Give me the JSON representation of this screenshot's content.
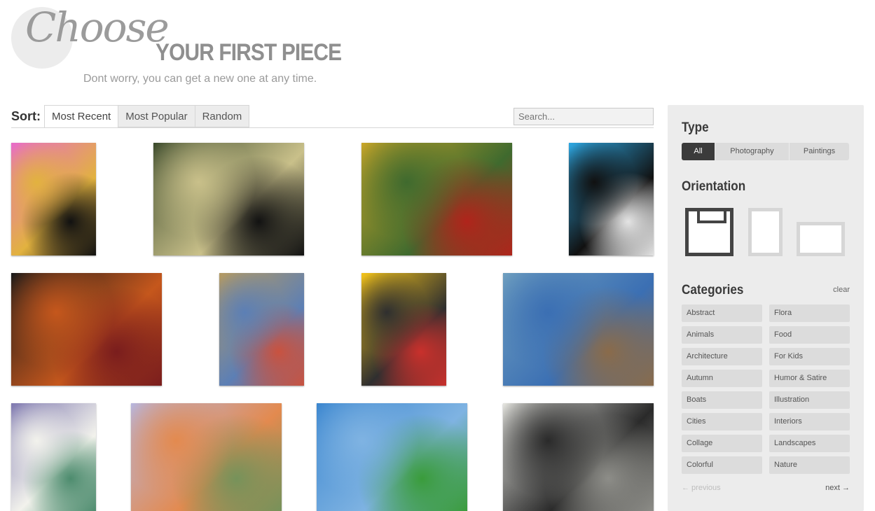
{
  "header": {
    "script_word": "Choose",
    "title": "YOUR FIRST PIECE",
    "subtitle": "Dont worry, you can get a new one at any time."
  },
  "sort": {
    "label": "Sort:",
    "tabs": [
      "Most Recent",
      "Most Popular",
      "Random"
    ],
    "active_tab": "Most Recent",
    "search_placeholder": "Search..."
  },
  "gallery": [
    {
      "name": "marilyn-license-plate-art",
      "colors": [
        "#e86cc9",
        "#e2b23f",
        "#111111"
      ]
    },
    {
      "name": "plaid-fabric-abstract",
      "colors": [
        "#3b4a2c",
        "#c9c08a",
        "#121212"
      ]
    },
    {
      "name": "harlequin-fabric-abstract",
      "colors": [
        "#c9a629",
        "#3f6a2e",
        "#b0241b"
      ]
    },
    {
      "name": "kurt-license-plate-art",
      "colors": [
        "#2ea8e3",
        "#111111",
        "#e4e4e4"
      ]
    },
    {
      "name": "dark-floral-abstract",
      "colors": [
        "#1a1a1a",
        "#c5571c",
        "#7a1d1d"
      ]
    },
    {
      "name": "colorful-swirl-painting",
      "colors": [
        "#b49a63",
        "#5c7fb5",
        "#c9523f"
      ]
    },
    {
      "name": "rosie-license-plate-art",
      "colors": [
        "#f3c31a",
        "#2f2f2f",
        "#c9302c"
      ]
    },
    {
      "name": "long-boat-photo",
      "colors": [
        "#6f9fbf",
        "#3b6fb3",
        "#8a6b4a"
      ]
    },
    {
      "name": "white-flowers-vase",
      "colors": [
        "#7f79b0",
        "#f2f2ec",
        "#4d8c6e"
      ]
    },
    {
      "name": "landscape-field-painting",
      "colors": [
        "#b7b6de",
        "#e38a4f",
        "#76925a"
      ]
    },
    {
      "name": "blue-sky-green-field",
      "colors": [
        "#3b86cf",
        "#7fb3e2",
        "#3a9c3b"
      ]
    },
    {
      "name": "why-not-bazar-photo",
      "colors": [
        "#e4e4df",
        "#2a2a2a",
        "#8d8d88"
      ]
    }
  ],
  "sidebar": {
    "type": {
      "heading": "Type",
      "options": [
        "All",
        "Photography",
        "Paintings"
      ],
      "selected": "All"
    },
    "orientation": {
      "heading": "Orientation",
      "options": [
        "square",
        "portrait",
        "landscape"
      ],
      "selected": "square"
    },
    "categories": {
      "heading": "Categories",
      "clear_label": "clear",
      "items": [
        "Abstract",
        "Flora",
        "Animals",
        "Food",
        "Architecture",
        "For Kids",
        "Autumn",
        "Humor & Satire",
        "Boats",
        "Illustration",
        "Cities",
        "Interiors",
        "Collage",
        "Landscapes",
        "Colorful",
        "Nature"
      ]
    },
    "pager": {
      "prev": "← previous",
      "next": "next →"
    }
  },
  "colors": {
    "sidebar_bg": "#ececec",
    "active_dark": "#3b3b3b",
    "heading_gray": "#8f8f8f"
  }
}
